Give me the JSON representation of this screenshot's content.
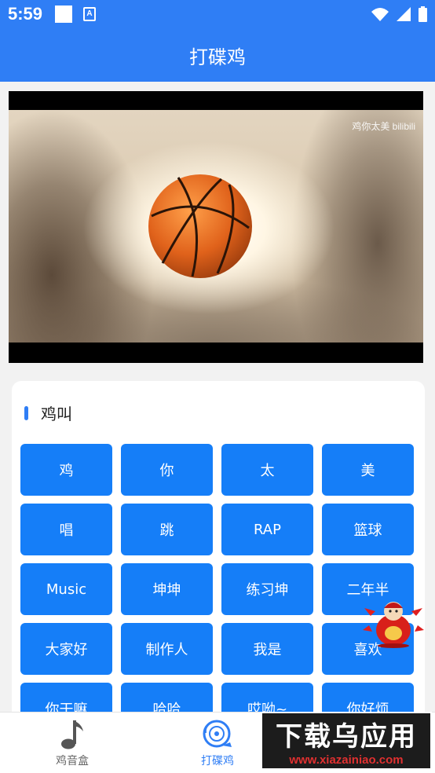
{
  "status_bar": {
    "time": "5:59",
    "a_icon": "A"
  },
  "app_bar": {
    "title": "打碟鸡"
  },
  "video": {
    "watermark": "鸡你太美 bilibili"
  },
  "section": {
    "title": "鸡叫"
  },
  "sound_buttons": [
    {
      "label": "鸡"
    },
    {
      "label": "你"
    },
    {
      "label": "太"
    },
    {
      "label": "美"
    },
    {
      "label": "唱"
    },
    {
      "label": "跳"
    },
    {
      "label": "RAP"
    },
    {
      "label": "篮球"
    },
    {
      "label": "Music"
    },
    {
      "label": "坤坤"
    },
    {
      "label": "练习坤"
    },
    {
      "label": "二年半"
    },
    {
      "label": "大家好"
    },
    {
      "label": "制作人"
    },
    {
      "label": "我是"
    },
    {
      "label": "喜欢"
    },
    {
      "label": "你干嘛"
    },
    {
      "label": "哈哈"
    },
    {
      "label": "哎呦~"
    },
    {
      "label": "你好烦"
    }
  ],
  "tabs": [
    {
      "label": "鸡音盒",
      "icon": "music-note-icon",
      "active": false
    },
    {
      "label": "打碟鸡",
      "icon": "disc-icon",
      "active": true
    }
  ],
  "overlay_ad": {
    "title": "下载乌应用",
    "url": "www.xiazainiao.com"
  },
  "colors": {
    "primary": "#2f7ef5",
    "button": "#157ef8",
    "background": "#f2f2f2"
  }
}
